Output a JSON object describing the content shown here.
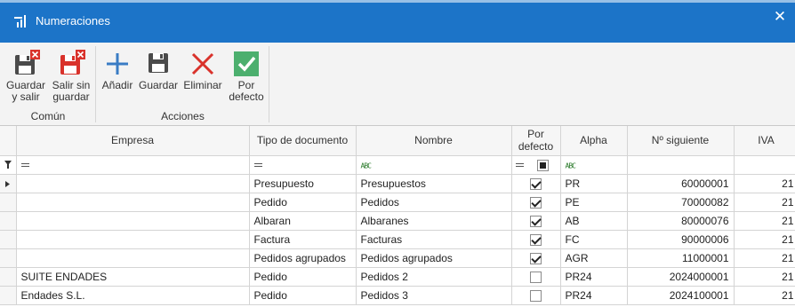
{
  "window": {
    "title": "Numeraciones",
    "close_glyph": "✕"
  },
  "ribbon": {
    "groups": [
      {
        "label": "Común"
      },
      {
        "label": "Acciones"
      }
    ],
    "buttons": {
      "save_close": {
        "line1": "Guardar",
        "line2": "y salir",
        "icon": "save-close-icon"
      },
      "exit_nosave": {
        "line1": "Salir sin",
        "line2": "guardar",
        "icon": "exit-no-save-icon"
      },
      "add": {
        "label": "Añadir",
        "icon": "plus-icon"
      },
      "save": {
        "label": "Guardar",
        "icon": "save-icon"
      },
      "delete": {
        "label": "Eliminar",
        "icon": "delete-x-icon"
      },
      "default": {
        "line1": "Por",
        "line2": "defecto",
        "icon": "check-icon"
      }
    }
  },
  "grid": {
    "columns": [
      {
        "line1": "Empresa"
      },
      {
        "line1": "Tipo de documento"
      },
      {
        "line1": "Nombre"
      },
      {
        "line1": "Por",
        "line2": "defecto"
      },
      {
        "line1": "Alpha"
      },
      {
        "line1": "Nº siguiente"
      },
      {
        "line1": "IVA"
      }
    ],
    "rows": [
      {
        "empresa": "",
        "tipo": "Presupuesto",
        "nombre": "Presupuestos",
        "defecto": true,
        "alpha": "PR",
        "siguiente": "60000001",
        "iva": "21"
      },
      {
        "empresa": "",
        "tipo": "Pedido",
        "nombre": "Pedidos",
        "defecto": true,
        "alpha": "PE",
        "siguiente": "70000082",
        "iva": "21"
      },
      {
        "empresa": "",
        "tipo": "Albaran",
        "nombre": "Albaranes",
        "defecto": true,
        "alpha": "AB",
        "siguiente": "80000076",
        "iva": "21"
      },
      {
        "empresa": "",
        "tipo": "Factura",
        "nombre": "Facturas",
        "defecto": true,
        "alpha": "FC",
        "siguiente": "90000006",
        "iva": "21"
      },
      {
        "empresa": "",
        "tipo": "Pedidos agrupados",
        "nombre": "Pedidos agrupados",
        "defecto": true,
        "alpha": "AGR",
        "siguiente": "11000001",
        "iva": "21"
      },
      {
        "empresa": "SUITE ENDADES",
        "tipo": "Pedido",
        "nombre": "Pedidos 2",
        "defecto": false,
        "alpha": "PR24",
        "siguiente": "2024000001",
        "iva": "21"
      },
      {
        "empresa": "Endades S.L.",
        "tipo": "Pedido",
        "nombre": "Pedidos 3",
        "defecto": false,
        "alpha": "PR24",
        "siguiente": "2024100001",
        "iva": "21"
      }
    ]
  },
  "colors": {
    "titlebar": "#1c74c8",
    "save_icon": "#4a4a4a",
    "exit_badge": "#d9322b",
    "plus": "#3a7cc4",
    "delete": "#d9322b",
    "check_bg": "#4caf6e"
  }
}
